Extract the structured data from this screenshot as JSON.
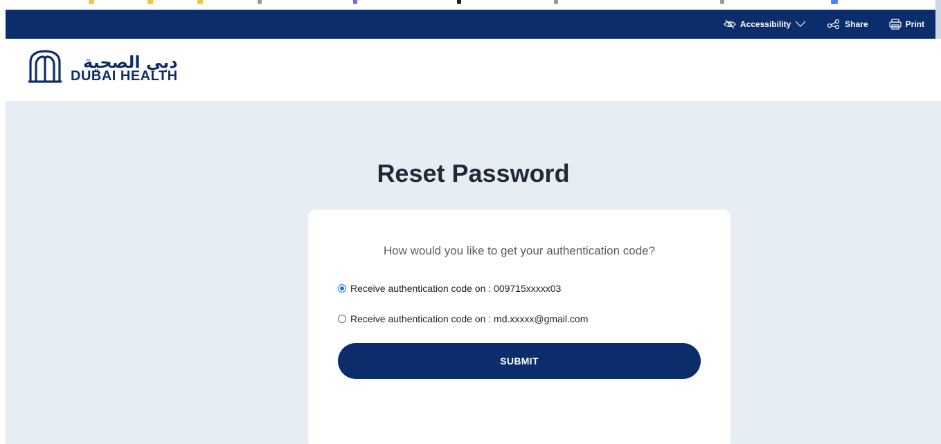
{
  "topbar": {
    "accessibility_label": "Accessibility",
    "share_label": "Share",
    "print_label": "Print"
  },
  "logo": {
    "arabic": "دبي الصحية",
    "english": "DUBAI HEALTH"
  },
  "page": {
    "title": "Reset Password"
  },
  "form": {
    "question": "How would you like to get your authentication code?",
    "options": [
      {
        "label": "Receive authentication code on : 009715xxxxx03",
        "selected": true
      },
      {
        "label": "Receive authentication code on : md.xxxxx@gmail.com",
        "selected": false
      }
    ],
    "submit_label": "SUBMIT"
  },
  "colors": {
    "brand_navy": "#0c2d6b",
    "page_background": "#e6eef3",
    "radio_selected": "#1a73e8"
  },
  "icons": {
    "accessibility": "eye-off-icon",
    "share": "share-icon",
    "print": "print-icon",
    "dropdown": "chevron-down-icon",
    "logo": "dubai-health-logo-icon"
  }
}
